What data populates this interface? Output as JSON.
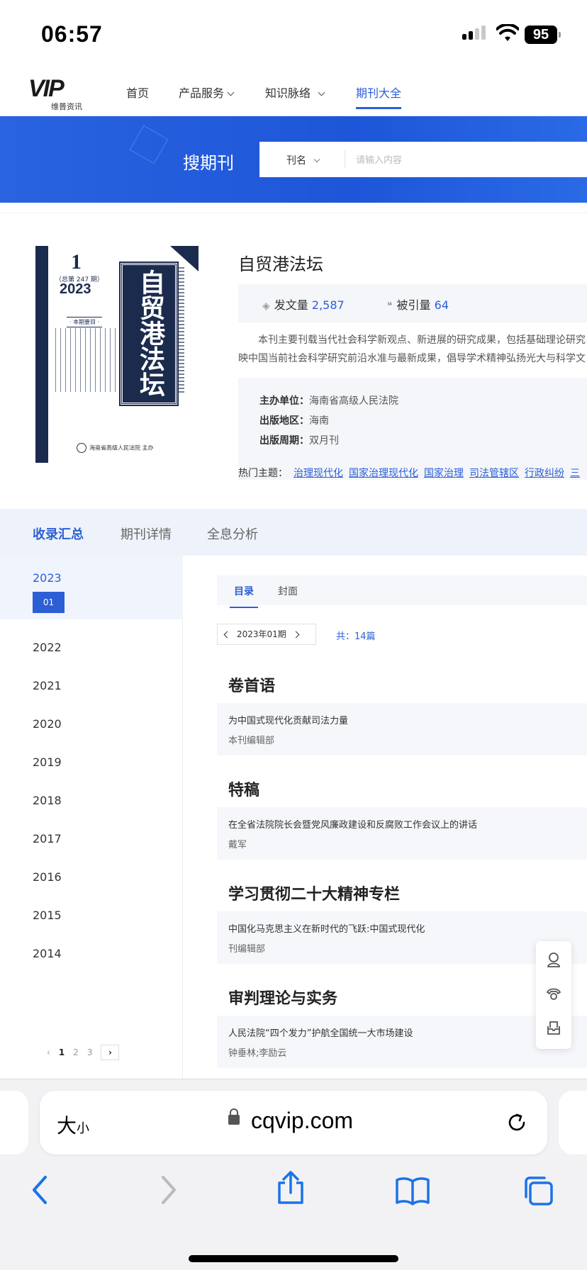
{
  "status": {
    "time": "06:57",
    "battery": "95"
  },
  "nav": {
    "logo_text": "VIP",
    "logo_sub": "维普资讯",
    "items": [
      {
        "label": "首页"
      },
      {
        "label": "产品服务"
      },
      {
        "label": "知识脉络"
      },
      {
        "label": "期刊大全"
      }
    ]
  },
  "banner": {
    "title": "搜期刊",
    "select_value": "刊名",
    "placeholder": "请输入内容"
  },
  "journal": {
    "title": "自贸港法坛",
    "cover": {
      "issue": "1",
      "total": "（总第 247 期）",
      "year": "2023",
      "toc_title": "· 本期要目 ·",
      "title_chars": "自贸港法坛",
      "publisher": "海南省高级人民法院  主办"
    },
    "stats": {
      "articles_label": "发文量",
      "articles_value": "2,587",
      "citations_label": "被引量",
      "citations_value": "64"
    },
    "description_1": "本刊主要刊载当代社会科学新观点、新进展的研究成果，包括基础理论研究",
    "description_2": "映中国当前社会科学研究前沿水准与最新成果，倡导学术精神弘扬光大与科学文",
    "meta": {
      "sponsor_label": "主办单位：",
      "sponsor_value": "海南省高级人民法院",
      "region_label": "出版地区：",
      "region_value": "海南",
      "cycle_label": "出版周期：",
      "cycle_value": "双月刊"
    },
    "topics_label": "热门主题：",
    "topics": [
      "治理现代化",
      "国家治理现代化",
      "国家治理",
      "司法管辖区",
      "行政纠纷",
      "三"
    ]
  },
  "tabs": [
    {
      "label": "收录汇总"
    },
    {
      "label": "期刊详情"
    },
    {
      "label": "全息分析"
    }
  ],
  "years": {
    "active_year": "2023",
    "active_issue": "01",
    "list": [
      "2022",
      "2021",
      "2020",
      "2019",
      "2018",
      "2017",
      "2016",
      "2015",
      "2014"
    ],
    "pager": {
      "pages": [
        "1",
        "2",
        "3"
      ]
    }
  },
  "contents": {
    "subtabs": [
      {
        "label": "目录"
      },
      {
        "label": "封面"
      }
    ],
    "issue_label": "2023年01期",
    "count": "共：14篇",
    "sections": [
      {
        "title": "卷首语",
        "article": "为中国式现代化贡献司法力量",
        "author": "本刊编辑部"
      },
      {
        "title": "特稿",
        "article": "在全省法院院长会暨党风廉政建设和反腐败工作会议上的讲话",
        "author": "戴军"
      },
      {
        "title": "学习贯彻二十大精神专栏",
        "article": "中国化马克思主义在新时代的飞跃:中国式现代化",
        "author": "刊编辑部"
      },
      {
        "title": "审判理论与实务",
        "article": "人民法院“四个发力”护航全国统一大市场建设",
        "author": "钟垂林;李励云"
      }
    ]
  },
  "safari": {
    "aa_big": "大",
    "aa_small": "小",
    "url": "cqvip.com"
  },
  "colors": {
    "accent": "#2c5fd6",
    "banner": "#1d56d8",
    "cover_navy": "#1b2b4d"
  }
}
